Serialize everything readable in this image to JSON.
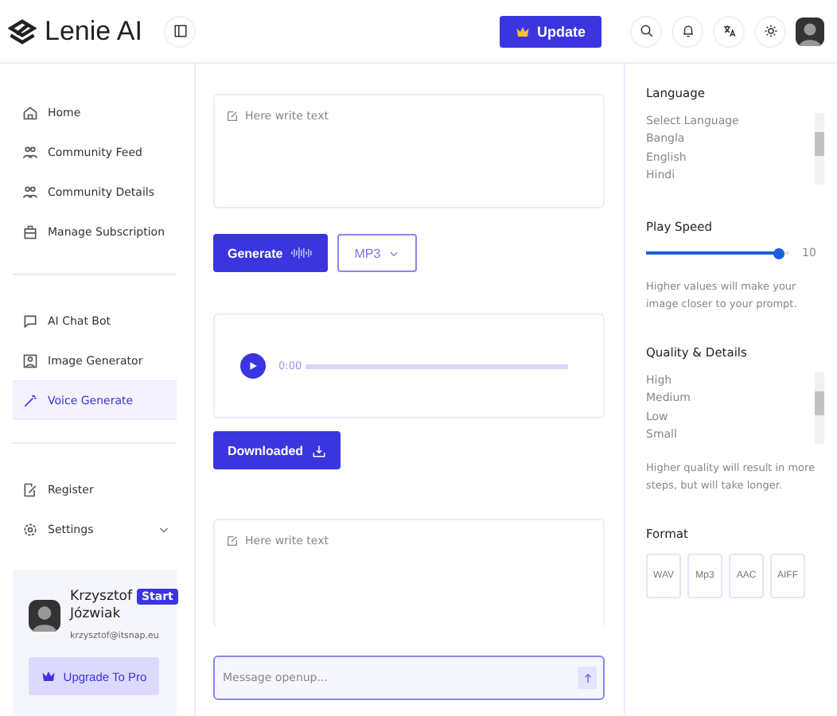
{
  "header": {
    "logo": "Lenie AI",
    "update_button": "Update"
  },
  "sidebar": {
    "groups": [
      [
        {
          "label": "Home",
          "selected": false
        },
        {
          "label": "Community Feed",
          "selected": false
        },
        {
          "label": "Community Details",
          "selected": false
        },
        {
          "label": "Manage Subscription",
          "selected": false
        }
      ],
      [
        {
          "label": "AI Chat Bot",
          "selected": false
        },
        {
          "label": "Image Generator",
          "selected": false
        },
        {
          "label": "Voice Generate",
          "selected": true
        }
      ],
      [
        {
          "label": "Register",
          "selected": false
        },
        {
          "label": "Settings",
          "selected": false,
          "expanded": false
        }
      ]
    ],
    "user": {
      "first_name": "Krzysztof",
      "last_name": "Józwiak",
      "badge": "Start",
      "email": "krzysztof@itsnap.eu",
      "upgrade_button": "Upgrade To Pro"
    }
  },
  "main": {
    "prompt": {
      "placeholder": "Here write text"
    },
    "generate_button": "Generate",
    "format_select": "MP3",
    "player": {
      "time": "0:00"
    },
    "download_button": "Downloaded",
    "second_prompt": {
      "placeholder": "Here write text"
    },
    "message": {
      "placeholder": "Message openup..."
    }
  },
  "settings": {
    "language": {
      "title": "Language",
      "options": [
        "Select Language",
        "Bangla",
        "English",
        "Hindi"
      ]
    },
    "play_speed": {
      "title": "Play Speed",
      "level": 0.93,
      "reading": "10",
      "help": "Higher values will make your image closer to your prompt."
    },
    "quality": {
      "title": "Quality & Details",
      "options": [
        "High",
        "Medium",
        "Low",
        "Small"
      ],
      "help": "Higher quality will result in more steps, but will take longer."
    },
    "format": {
      "title": "Format",
      "options": [
        "WAV",
        "Mp3",
        "AAC",
        "AIFF"
      ]
    }
  }
}
